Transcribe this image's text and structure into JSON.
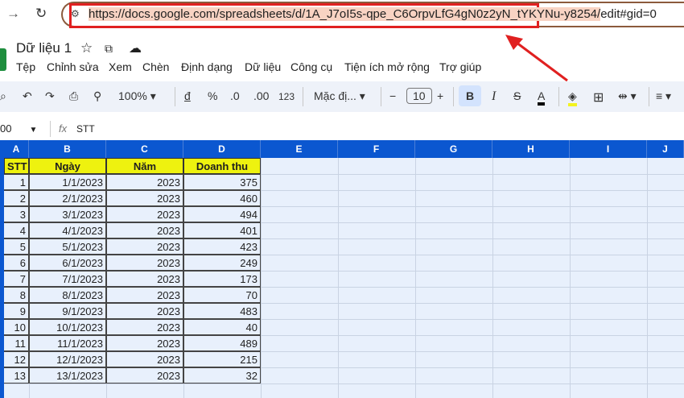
{
  "browser": {
    "url_highlighted": "https://docs.google.com/spreadsheets/d/1A_J7oI5s-qpe_C6OrpvLfG4gN0z2yN_tYKYNu-y8254/",
    "url_rest": "edit#gid=0"
  },
  "doc": {
    "title": "Dữ liệu 1"
  },
  "menu": [
    "Tệp",
    "Chỉnh sửa",
    "Xem",
    "Chèn",
    "Định dạng",
    "Dữ liệu",
    "Công cụ",
    "Tiện ích mở rộng",
    "Trợ giúp"
  ],
  "toolbar": {
    "zoom": "100%",
    "currency": "đ",
    "percent": "%",
    "dec_less": ".0",
    "dec_more": ".00",
    "format_more": "123",
    "font": "Mặc đị...",
    "font_size": "10",
    "bold": "B",
    "italic": "I",
    "text_color": "A"
  },
  "formula_bar": {
    "cell_ref": "00",
    "fx": "fx",
    "content": "STT"
  },
  "columns": [
    "A",
    "B",
    "C",
    "D",
    "E",
    "F",
    "G",
    "H",
    "I",
    "J"
  ],
  "header_row": [
    "STT",
    "Ngày",
    "Năm",
    "Doanh thu"
  ],
  "rows": [
    [
      "1",
      "1/1/2023",
      "2023",
      "375"
    ],
    [
      "2",
      "2/1/2023",
      "2023",
      "460"
    ],
    [
      "3",
      "3/1/2023",
      "2023",
      "494"
    ],
    [
      "4",
      "4/1/2023",
      "2023",
      "401"
    ],
    [
      "5",
      "5/1/2023",
      "2023",
      "423"
    ],
    [
      "6",
      "6/1/2023",
      "2023",
      "249"
    ],
    [
      "7",
      "7/1/2023",
      "2023",
      "173"
    ],
    [
      "8",
      "8/1/2023",
      "2023",
      "70"
    ],
    [
      "9",
      "9/1/2023",
      "2023",
      "483"
    ],
    [
      "10",
      "10/1/2023",
      "2023",
      "40"
    ],
    [
      "11",
      "11/1/2023",
      "2023",
      "489"
    ],
    [
      "12",
      "12/1/2023",
      "2023",
      "215"
    ],
    [
      "13",
      "13/1/2023",
      "2023",
      "32"
    ]
  ],
  "colors": {
    "header_fill": "#eef20f",
    "column_header": "#0b57d0",
    "cell_bg": "#e8f0fc",
    "annotation": "#e02020"
  }
}
